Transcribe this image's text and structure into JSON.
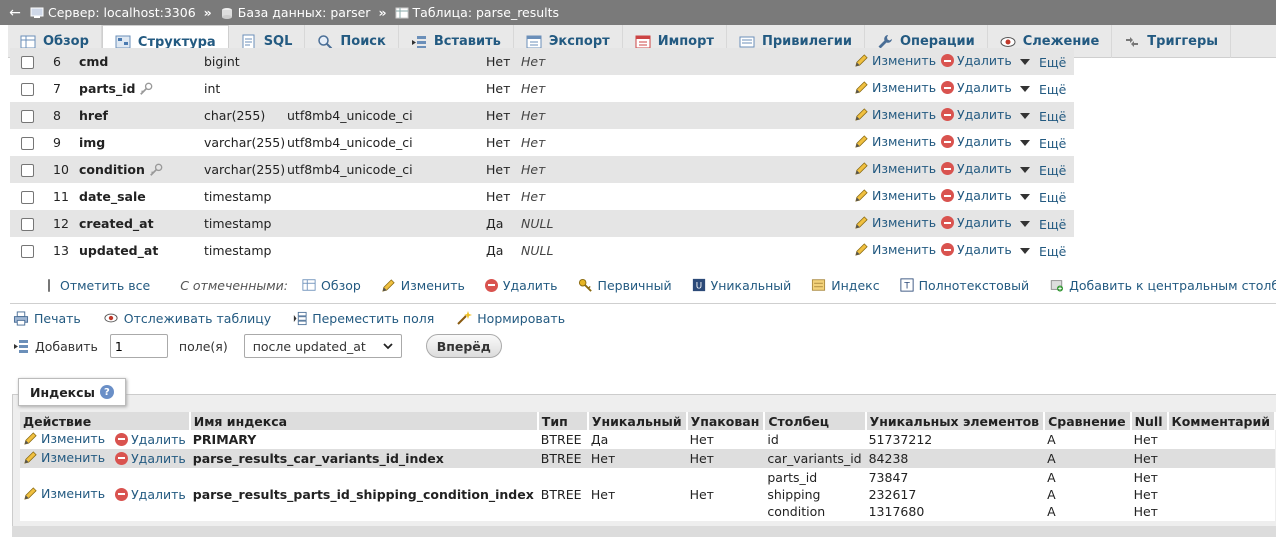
{
  "topbar": {
    "server": "Сервер: localhost:3306",
    "database": "База данных: parser",
    "table": "Таблица: parse_results"
  },
  "tabs": [
    {
      "label": "Обзор",
      "icon": "browse-icon"
    },
    {
      "label": "Структура",
      "icon": "structure-icon"
    },
    {
      "label": "SQL",
      "icon": "sql-icon"
    },
    {
      "label": "Поиск",
      "icon": "search-icon"
    },
    {
      "label": "Вставить",
      "icon": "insert-icon"
    },
    {
      "label": "Экспорт",
      "icon": "export-icon"
    },
    {
      "label": "Импорт",
      "icon": "import-icon"
    },
    {
      "label": "Привилегии",
      "icon": "privileges-icon"
    },
    {
      "label": "Операции",
      "icon": "wrench-icon"
    },
    {
      "label": "Слежение",
      "icon": "eye-icon"
    },
    {
      "label": "Триггеры",
      "icon": "triggers-icon"
    }
  ],
  "columns": [
    {
      "num": "6",
      "name": "cmd",
      "type": "bigint",
      "collation": "",
      "null": "Нет",
      "default": "Нет",
      "has_key": false
    },
    {
      "num": "7",
      "name": "parts_id",
      "type": "int",
      "collation": "",
      "null": "Нет",
      "default": "Нет",
      "has_key": true
    },
    {
      "num": "8",
      "name": "href",
      "type": "char(255)",
      "collation": "utf8mb4_unicode_ci",
      "null": "Нет",
      "default": "Нет",
      "has_key": false
    },
    {
      "num": "9",
      "name": "img",
      "type": "varchar(255)",
      "collation": "utf8mb4_unicode_ci",
      "null": "Нет",
      "default": "Нет",
      "has_key": false
    },
    {
      "num": "10",
      "name": "condition",
      "type": "varchar(255)",
      "collation": "utf8mb4_unicode_ci",
      "null": "Нет",
      "default": "Нет",
      "has_key": true
    },
    {
      "num": "11",
      "name": "date_sale",
      "type": "timestamp",
      "collation": "",
      "null": "Нет",
      "default": "Нет",
      "has_key": false
    },
    {
      "num": "12",
      "name": "created_at",
      "type": "timestamp",
      "collation": "",
      "null": "Да",
      "default": "NULL",
      "has_key": false
    },
    {
      "num": "13",
      "name": "updated_at",
      "type": "timestamp",
      "collation": "",
      "null": "Да",
      "default": "NULL",
      "has_key": false
    }
  ],
  "row_actions": {
    "edit": "Изменить",
    "delete": "Удалить",
    "more": "Ещё"
  },
  "bulk": {
    "check_all": "Отметить все",
    "with_selected": "С отмеченными:",
    "browse": "Обзор",
    "edit": "Изменить",
    "delete": "Удалить",
    "primary": "Первичный",
    "unique": "Уникальный",
    "index": "Индекс",
    "fulltext": "Полнотекстовый",
    "add_central": "Добавить к центральным столбцам"
  },
  "tools": {
    "print": "Печать",
    "track": "Отслеживать таблицу",
    "move": "Переместить поля",
    "normalize": "Нормировать"
  },
  "add": {
    "label": "Добавить",
    "count": "1",
    "fields": "поле(я)",
    "position": "после updated_at",
    "go": "Вперёд"
  },
  "indexes": {
    "legend": "Индексы",
    "headers": [
      "Действие",
      "Имя индекса",
      "Тип",
      "Уникальный",
      "Упакован",
      "Столбец",
      "Уникальных элементов",
      "Сравнение",
      "Null",
      "Комментарий"
    ],
    "rows": [
      {
        "name": "PRIMARY",
        "type": "BTREE",
        "unique": "Да",
        "packed": "Нет",
        "parts": [
          {
            "column": "id",
            "card": "51737212",
            "coll": "A",
            "null": "Нет"
          }
        ]
      },
      {
        "name": "parse_results_car_variants_id_index",
        "type": "BTREE",
        "unique": "Нет",
        "packed": "Нет",
        "parts": [
          {
            "column": "car_variants_id",
            "card": "84238",
            "coll": "A",
            "null": "Нет"
          }
        ]
      },
      {
        "name": "parse_results_parts_id_shipping_condition_index",
        "type": "BTREE",
        "unique": "Нет",
        "packed": "Нет",
        "parts": [
          {
            "column": "parts_id",
            "card": "73847",
            "coll": "A",
            "null": "Нет"
          },
          {
            "column": "shipping",
            "card": "232617",
            "coll": "A",
            "null": "Нет"
          },
          {
            "column": "condition",
            "card": "1317680",
            "coll": "A",
            "null": "Нет"
          }
        ]
      }
    ]
  }
}
